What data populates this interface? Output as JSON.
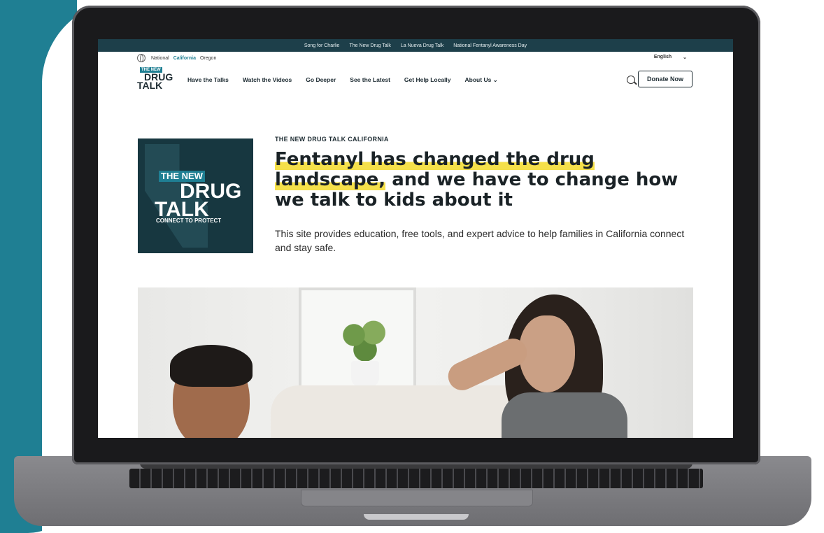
{
  "topbar": {
    "links": [
      "Song for Charlie",
      "The New Drug Talk",
      "La Nueva Drug Talk",
      "National Fentanyl Awareness Day"
    ]
  },
  "utility": {
    "regions": [
      "National",
      "California",
      "Oregon"
    ],
    "active_region": "California",
    "language": "English",
    "language_caret": "⌄"
  },
  "logo": {
    "line1": "THE NEW",
    "line2": "DRUG",
    "line3": "TALK"
  },
  "nav": {
    "items": [
      "Have the Talks",
      "Watch the Videos",
      "Go Deeper",
      "See the Latest",
      "Get Help Locally",
      "About Us ⌄"
    ],
    "donate_label": "Donate Now"
  },
  "hero": {
    "badge": {
      "line1": "THE NEW",
      "line2": "DRUG",
      "line3": "TALK",
      "tagline": "CONNECT TO PROTECT"
    },
    "eyebrow": "THE NEW DRUG TALK CALIFORNIA",
    "headline_highlight": "Fentanyl has changed the drug landscape,",
    "headline_rest": " and we have to change how we talk to kids about it",
    "lede": "This site provides education, free tools, and expert advice to help families in California connect and stay safe."
  },
  "colors": {
    "accent": "#1f7f93",
    "dark": "#1d3f4a",
    "highlight": "#f5e04a"
  }
}
